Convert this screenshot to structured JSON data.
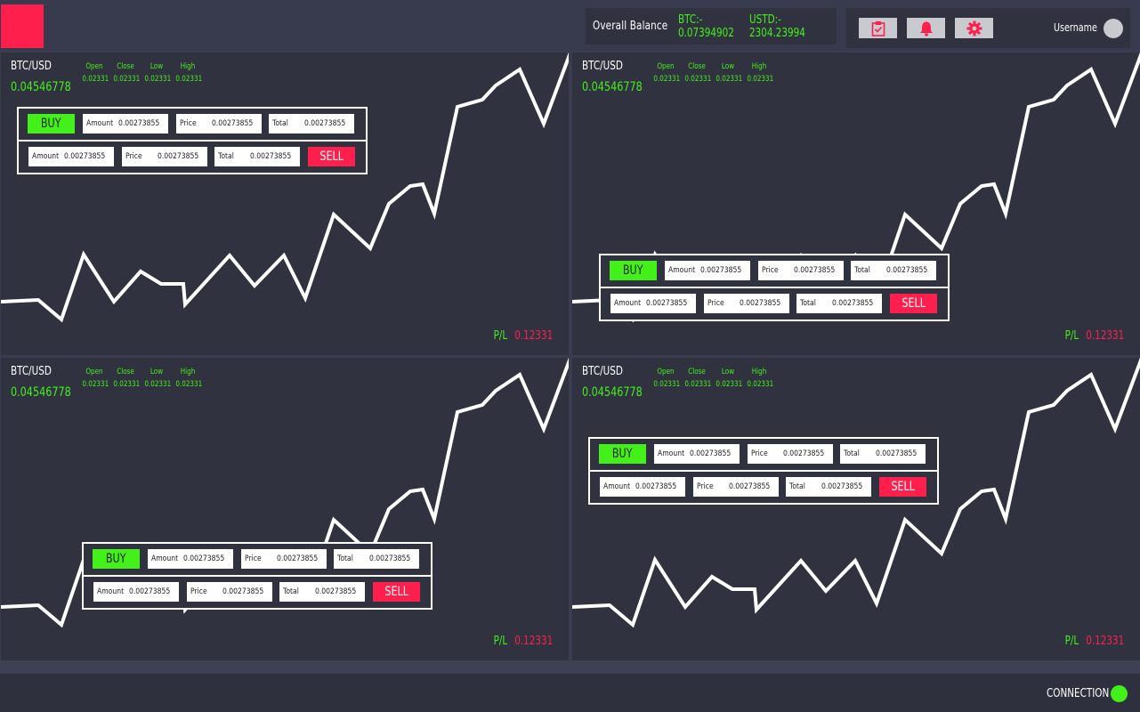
{
  "header": {
    "balance_title": "Overall Balance",
    "btc_label": "BTC:-",
    "btc_value": "0.07394902",
    "usdt_label": "USTD:-",
    "usdt_value": "2304.23994",
    "username": "Username",
    "icons": [
      "clipboard-check-icon",
      "bell-icon",
      "gear-icon"
    ],
    "accent_color": "#ff1f4d"
  },
  "colors": {
    "positive": "#44f01a",
    "negative": "#ff1f4d",
    "panel": "#30333f",
    "background": "#3a3d4f"
  },
  "panels": [
    {
      "pair": "BTC/USD",
      "price": "0.04546778",
      "ohlc": [
        {
          "label": "Open",
          "value": "0.02331"
        },
        {
          "label": "Close",
          "value": "0.02331"
        },
        {
          "label": "Low",
          "value": "0.02331"
        },
        {
          "label": "High",
          "value": "0.02331"
        }
      ],
      "order": {
        "buy_label": "BUY",
        "sell_label": "SELL",
        "buy_fields": [
          {
            "label": "Amount",
            "value": "0.00273855"
          },
          {
            "label": "Price",
            "value": "0.00273855"
          },
          {
            "label": "Total",
            "value": "0.00273855"
          }
        ],
        "sell_fields": [
          {
            "label": "Amount",
            "value": "0.00273855"
          },
          {
            "label": "Price",
            "value": "0.00273855"
          },
          {
            "label": "Total",
            "value": "0.00273855"
          }
        ]
      },
      "pl_label": "P/L",
      "pl_value": "0.12331"
    },
    {
      "pair": "BTC/USD",
      "price": "0.04546778",
      "ohlc": [
        {
          "label": "Open",
          "value": "0.02331"
        },
        {
          "label": "Close",
          "value": "0.02331"
        },
        {
          "label": "Low",
          "value": "0.02331"
        },
        {
          "label": "High",
          "value": "0.02331"
        }
      ],
      "order": {
        "buy_label": "BUY",
        "sell_label": "SELL",
        "buy_fields": [
          {
            "label": "Amount",
            "value": "0.00273855"
          },
          {
            "label": "Price",
            "value": "0.00273855"
          },
          {
            "label": "Total",
            "value": "0.00273855"
          }
        ],
        "sell_fields": [
          {
            "label": "Amount",
            "value": "0.00273855"
          },
          {
            "label": "Price",
            "value": "0.00273855"
          },
          {
            "label": "Total",
            "value": "0.00273855"
          }
        ]
      },
      "pl_label": "P/L",
      "pl_value": "0.12331"
    },
    {
      "pair": "BTC/USD",
      "price": "0.04546778",
      "ohlc": [
        {
          "label": "Open",
          "value": "0.02331"
        },
        {
          "label": "Close",
          "value": "0.02331"
        },
        {
          "label": "Low",
          "value": "0.02331"
        },
        {
          "label": "High",
          "value": "0.02331"
        }
      ],
      "order": {
        "buy_label": "BUY",
        "sell_label": "SELL",
        "buy_fields": [
          {
            "label": "Amount",
            "value": "0.00273855"
          },
          {
            "label": "Price",
            "value": "0.00273855"
          },
          {
            "label": "Total",
            "value": "0.00273855"
          }
        ],
        "sell_fields": [
          {
            "label": "Amount",
            "value": "0.00273855"
          },
          {
            "label": "Price",
            "value": "0.00273855"
          },
          {
            "label": "Total",
            "value": "0.00273855"
          }
        ]
      },
      "pl_label": "P/L",
      "pl_value": "0.12331"
    },
    {
      "pair": "BTC/USD",
      "price": "0.04546778",
      "ohlc": [
        {
          "label": "Open",
          "value": "0.02331"
        },
        {
          "label": "Close",
          "value": "0.02331"
        },
        {
          "label": "Low",
          "value": "0.02331"
        },
        {
          "label": "High",
          "value": "0.02331"
        }
      ],
      "order": {
        "buy_label": "BUY",
        "sell_label": "SELL",
        "buy_fields": [
          {
            "label": "Amount",
            "value": "0.00273855"
          },
          {
            "label": "Price",
            "value": "0.00273855"
          },
          {
            "label": "Total",
            "value": "0.00273855"
          }
        ],
        "sell_fields": [
          {
            "label": "Amount",
            "value": "0.00273855"
          },
          {
            "label": "Price",
            "value": "0.00273855"
          },
          {
            "label": "Total",
            "value": "0.00273855"
          }
        ]
      },
      "pl_label": "P/L",
      "pl_value": "0.12331"
    }
  ],
  "status": {
    "connection_label": "CONNECTION",
    "connection_color": "#44f01a"
  }
}
